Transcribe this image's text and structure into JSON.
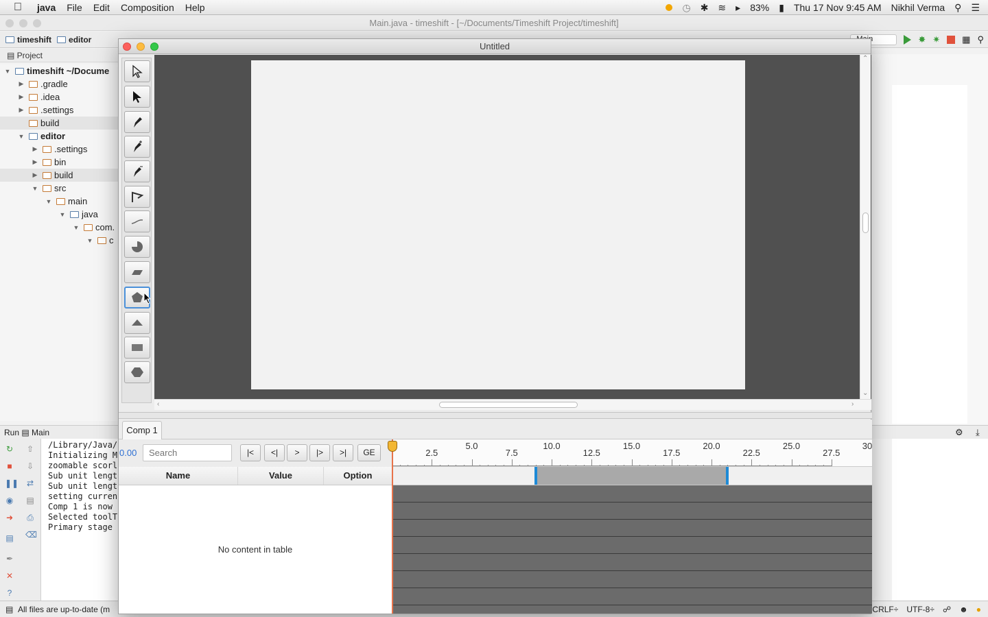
{
  "menubar": {
    "app": "java",
    "items": [
      "File",
      "Edit",
      "Composition",
      "Help"
    ],
    "battery": "83%",
    "datetime": "Thu 17 Nov  9:45 AM",
    "user": "Nikhil Verma"
  },
  "ide": {
    "title": "Main.java - timeshift - [~/Documents/Timeshift Project/timeshift]",
    "breadcrumbs": [
      "timeshift",
      "editor"
    ],
    "run_config": "Main",
    "project_label": "Project",
    "tree": [
      {
        "label": "timeshift ~/Docume",
        "depth": 0,
        "arrow": "▼",
        "bold": true,
        "icon": "folder-blue"
      },
      {
        "label": ".gradle",
        "depth": 1,
        "arrow": "▶",
        "icon": "folder"
      },
      {
        "label": ".idea",
        "depth": 1,
        "arrow": "▶",
        "icon": "folder"
      },
      {
        "label": ".settings",
        "depth": 1,
        "arrow": "▶",
        "icon": "folder"
      },
      {
        "label": "build",
        "depth": 1,
        "arrow": "",
        "icon": "folder",
        "sel": true
      },
      {
        "label": "editor",
        "depth": 1,
        "arrow": "▼",
        "bold": true,
        "icon": "folder-blue"
      },
      {
        "label": ".settings",
        "depth": 2,
        "arrow": "▶",
        "icon": "folder"
      },
      {
        "label": "bin",
        "depth": 2,
        "arrow": "▶",
        "icon": "folder"
      },
      {
        "label": "build",
        "depth": 2,
        "arrow": "▶",
        "icon": "folder",
        "sel": true
      },
      {
        "label": "src",
        "depth": 2,
        "arrow": "▼",
        "icon": "folder"
      },
      {
        "label": "main",
        "depth": 3,
        "arrow": "▼",
        "icon": "folder"
      },
      {
        "label": "java",
        "depth": 4,
        "arrow": "▼",
        "icon": "folder-blue"
      },
      {
        "label": "com.",
        "depth": 5,
        "arrow": "▼",
        "icon": "folder"
      },
      {
        "label": "c",
        "depth": 6,
        "arrow": "▼",
        "icon": "folder"
      }
    ],
    "run_tab": "Run",
    "run_config_tab": "Main",
    "console": [
      "/Library/Java/",
      "Initializing M",
      "zoomable scorl",
      "Sub unit lengt",
      "Sub unit lengt",
      "setting curren",
      "Comp 1 is now",
      "Selected toolT",
      "Primary stage"
    ],
    "status": "All files are up-to-date (m",
    "line_sep": "CRLF",
    "encoding": "UTF-8"
  },
  "app": {
    "title": "Untitled",
    "comp_tab": "Comp 1",
    "time": "0.00",
    "search_placeholder": "Search",
    "nav_buttons": [
      "|<",
      "<|",
      ">",
      "|>",
      ">|",
      "GE"
    ],
    "columns": [
      "Name",
      "Value",
      "Option"
    ],
    "empty_table": "No content in table",
    "ruler_labels": [
      "0",
      "2.5",
      "5.0",
      "7.5",
      "10.0",
      "12.5",
      "15.0",
      "17.5",
      "20.0",
      "22.5",
      "25.0",
      "27.5",
      "30"
    ],
    "tools": [
      "select-arrow",
      "direct-select-arrow",
      "pen",
      "add-anchor-pen",
      "convert-anchor-pen",
      "polyline",
      "curve",
      "pie",
      "parallelogram",
      "pentagon",
      "triangle",
      "rectangle",
      "hexagon"
    ],
    "active_tool": "pentagon",
    "work_area_start": 9.0,
    "work_area_end": 21.0,
    "playhead_time": 0.0
  }
}
